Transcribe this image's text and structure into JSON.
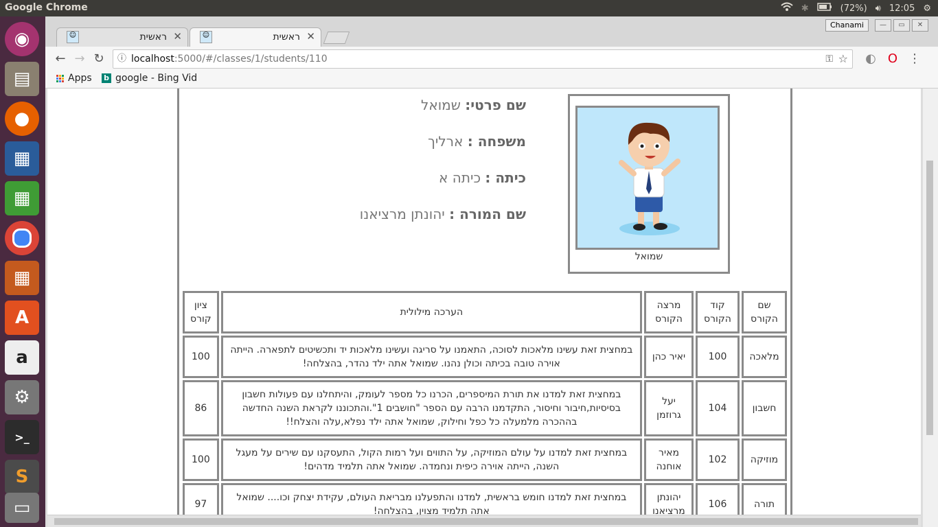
{
  "os_panel": {
    "app_name": "Google Chrome",
    "battery": "(72%)",
    "time": "12:05"
  },
  "launcher": {
    "icons": [
      "ubuntu-logo-icon",
      "files-icon",
      "firefox-icon",
      "writer-icon",
      "calc-icon",
      "chrome-icon",
      "impress-icon",
      "software-center-icon",
      "amazon-icon",
      "settings-icon",
      "terminal-icon",
      "sublime-icon",
      "disk-icon"
    ]
  },
  "browser": {
    "profile_name": "Chanami",
    "tabs": [
      {
        "title": "ראשית"
      },
      {
        "title": "ראשית"
      }
    ],
    "url_host": "localhost",
    "url_rest": ":5000/#/classes/1/students/110",
    "bookmarks": {
      "apps_label": "Apps",
      "bing_label": "google - Bing Vid"
    }
  },
  "student": {
    "first_name_label": "שם פרטי:",
    "first_name": "שמואל",
    "last_name_label": "משפחה :",
    "last_name": "ארליך",
    "class_label": "כיתה :",
    "class_name": "כיתה א",
    "teacher_label": "שם המורה :",
    "teacher_name": "יהונתן מרציאנו",
    "photo_caption": "שמואל"
  },
  "grades_table": {
    "headers": {
      "course_name": "שם הקורס",
      "course_code": "קוד הקורס",
      "lecturer": "מרצה הקורס",
      "assessment": "הערכה מילולית",
      "grade": "ציון קורס"
    },
    "rows": [
      {
        "course_name": "מלאכה",
        "course_code": "100",
        "lecturer": "יאיר כהן",
        "assessment": "במחצית זאת עשינו מלאכות לסוכה, התאמנו על סריגה ועשינו מלאכות יד ותכשיטים לתפארה. הייתה אוירה טובה בכיתה וכולן נהנו. שמואל אתה ילד נהדר, בהצלחה!",
        "grade": "100"
      },
      {
        "course_name": "חשבון",
        "course_code": "104",
        "lecturer": "יעל גרוזמן",
        "assessment": "במחצית זאת למדנו את תורת המיספרים, הכרנו כל מספר לעומק, והיתחלנו עם פעולות חשבון בסיסיות,חיבור וחיסור, התקדמנו הרבה עם הספר \"חושבים 1\".והתכוננו לקראת השנה החדשה בההכרה מלמעלה כל כפל וחילוק, שמואל אתה ילד נפלא,עלה והצלח!!",
        "grade": "86"
      },
      {
        "course_name": "מוזיקה",
        "course_code": "102",
        "lecturer": "מאיר אוחנה",
        "assessment": "במחצית זאת למדנו על עולם המוזיקה, על התווים ועל רמות הקול, התעסקנו עם שירים על מעגל השנה, הייתה אוירה כיפית ונחמדה. שמואל אתה תלמיד מדהים!",
        "grade": "100"
      },
      {
        "course_name": "תורה",
        "course_code": "106",
        "lecturer": "יהונתן מרציאנו",
        "assessment": "במחצית זאת למדנו חומש בראשית, למדנו והתפעלנו מבריאת העולם, עקידת יצחק וכו.... שמואל אתה תלמיד מצוין, בהצלחה!",
        "grade": "97"
      }
    ]
  }
}
